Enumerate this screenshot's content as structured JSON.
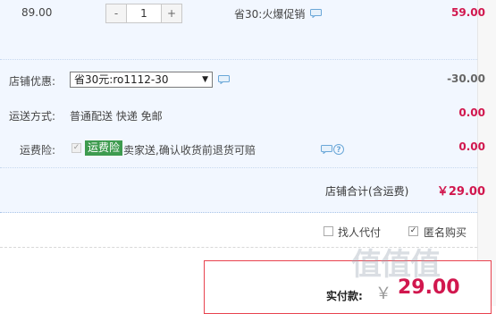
{
  "item": {
    "price": "89.00",
    "quantity": "1",
    "minus_label": "-",
    "plus_label": "+",
    "promotion": "省30:火爆促销",
    "subtotal": "59.00"
  },
  "shop_discount": {
    "label": "店铺优惠:",
    "selected": "省30元:ro1112-30",
    "amount": "-30.00"
  },
  "shipping": {
    "label": "运送方式:",
    "value": "普通配送 快递 免邮",
    "amount": "0.00"
  },
  "insurance": {
    "label": "运费险:",
    "tag": "运费险",
    "desc": "卖家送,确认收货前退货可赔",
    "amount": "0.00"
  },
  "shop_total": {
    "label": "店铺合计(含运费)",
    "amount": "￥29.00"
  },
  "options": {
    "proxy_pay": "找人代付",
    "anonymous": "匿名购买"
  },
  "payment": {
    "label": "实付款:",
    "currency": "￥",
    "amount": "29.00"
  },
  "watermark": "值值值",
  "colors": {
    "accent": "#d1174e",
    "panel_bg": "#f2f7ff",
    "tag_green": "#3e9b4f",
    "border_red": "#e8424e"
  },
  "icons": [
    "chat-icon",
    "help-icon",
    "dropdown-arrow-icon",
    "checkbox-checked-icon"
  ]
}
